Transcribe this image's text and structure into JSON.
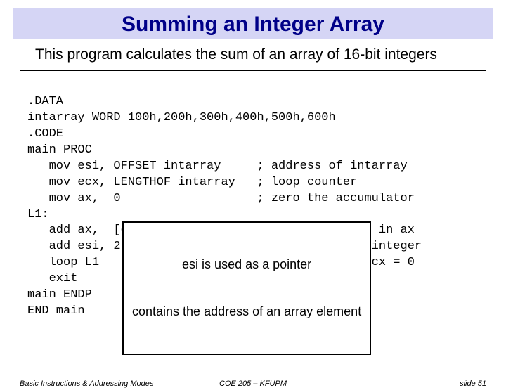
{
  "title": "Summing an Integer Array",
  "subtitle": "This program calculates the sum of an array of 16-bit integers",
  "code": {
    "l1": ".DATA",
    "l2": "intarray WORD 100h,200h,300h,400h,500h,600h",
    "l3": ".CODE",
    "l4": "main PROC",
    "l5": "   mov esi, OFFSET intarray     ; address of intarray",
    "l6": "   mov ecx, LENGTHOF intarray   ; loop counter",
    "l7": "   mov ax,  0                   ; zero the accumulator",
    "l8": "L1:",
    "l9": "   add ax,  [esi]               ; accumulate sum in ax",
    "l10": "   add esi, 2                   ; point to next integer",
    "l11": "   loop L1                      ; repeat until ecx = 0",
    "l12": "   exit",
    "l13": "main ENDP",
    "l14": "END main"
  },
  "callout": {
    "line1": "esi is used as a pointer",
    "line2": "contains the address of an array element"
  },
  "footer": {
    "left": "Basic Instructions & Addressing Modes",
    "center": "COE 205 – KFUPM",
    "right": "slide 51"
  }
}
